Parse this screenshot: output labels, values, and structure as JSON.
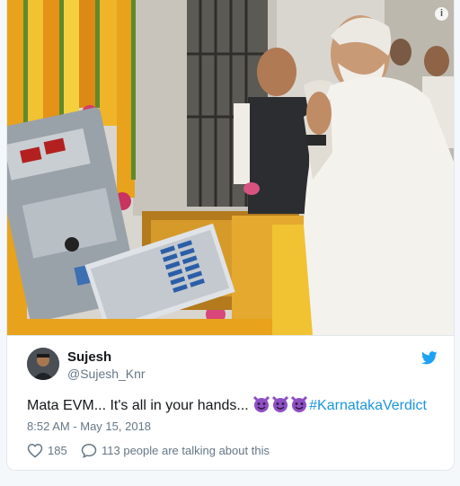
{
  "tweet": {
    "display_name": "Sujesh",
    "handle": "@Sujesh_Knr",
    "text": "Mata EVM... It's all in your hands... ",
    "emoji_count": 3,
    "hashtag": "#KarnatakaVerdict",
    "timestamp": "8:52 AM - May 15, 2018",
    "like_count": "185",
    "replies_text": "113 people are talking about this"
  },
  "media": {
    "info_label": "i"
  },
  "icons": {
    "twitter": "twitter-bird-icon",
    "like": "heart-icon",
    "reply": "speech-bubble-icon",
    "emoji": "smiling-imp-emoji-icon"
  },
  "colors": {
    "accent": "#1da1f2",
    "hashtag": "#1b95e0",
    "secondary_text": "#657786",
    "primary_text": "#14171a",
    "emoji_purple": "#8e4fc4"
  }
}
